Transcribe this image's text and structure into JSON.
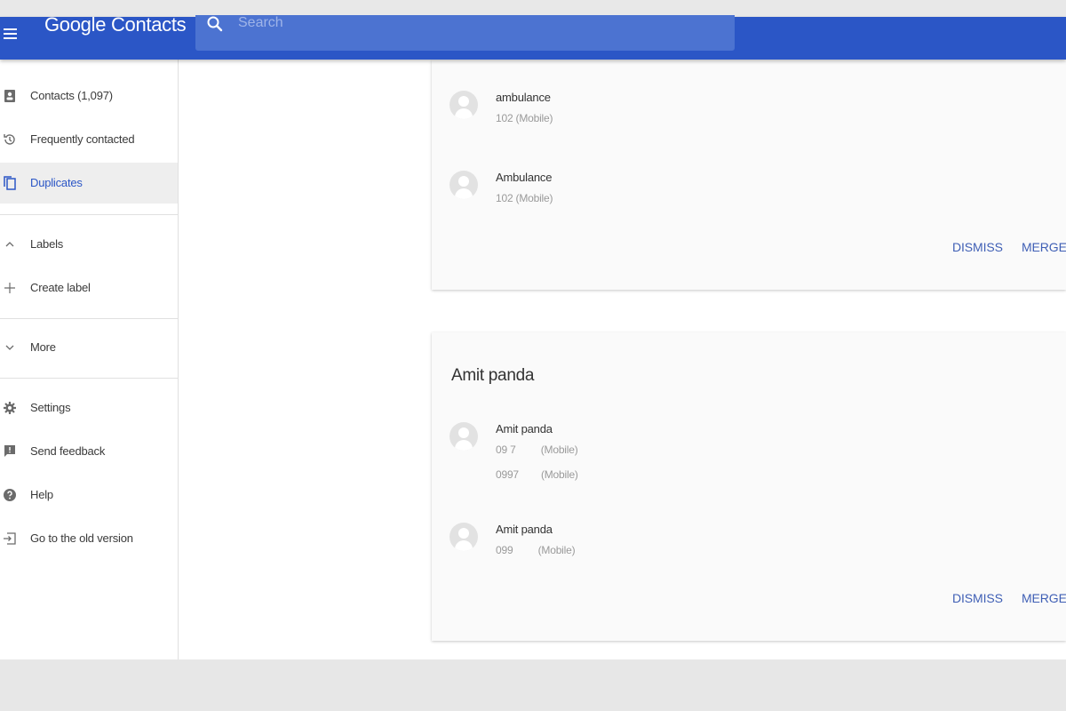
{
  "app": {
    "title": "Google Contacts"
  },
  "search": {
    "placeholder": "Search"
  },
  "sidebar": {
    "items": [
      {
        "label": "Contacts (1,097)",
        "icon": "contacts-icon"
      },
      {
        "label": "Frequently contacted",
        "icon": "history-icon"
      },
      {
        "label": "Duplicates",
        "icon": "duplicates-icon",
        "active": true
      },
      {
        "label": "Labels",
        "icon": "chevron-up-icon"
      },
      {
        "label": "Create label",
        "icon": "plus-icon"
      },
      {
        "label": "More",
        "icon": "chevron-down-icon"
      },
      {
        "label": "Settings",
        "icon": "gear-icon"
      },
      {
        "label": "Send feedback",
        "icon": "feedback-icon"
      },
      {
        "label": "Help",
        "icon": "help-icon"
      },
      {
        "label": "Go to the old version",
        "icon": "exit-icon"
      }
    ]
  },
  "cards": [
    {
      "title": "",
      "contacts": [
        {
          "name": "ambulance",
          "lines": [
            "102 (Mobile)"
          ]
        },
        {
          "name": "Ambulance",
          "lines": [
            "102 (Mobile)"
          ]
        }
      ],
      "dismiss_label": "DISMISS",
      "merge_label": "MERGE"
    },
    {
      "title": "Amit panda",
      "contacts": [
        {
          "name": "Amit panda",
          "lines": [
            "09 7         (Mobile)",
            "0997        (Mobile)"
          ]
        },
        {
          "name": "Amit panda",
          "lines": [
            "099         (Mobile)"
          ]
        }
      ],
      "dismiss_label": "DISMISS",
      "merge_label": "MERGE"
    }
  ],
  "colors": {
    "appbar": "#2b56c6",
    "accent": "#3f5fb5",
    "active_bg": "#eeeeee"
  }
}
